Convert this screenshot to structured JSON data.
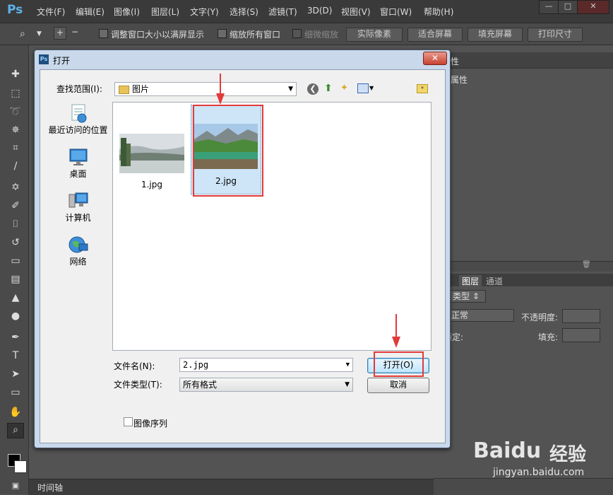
{
  "app": {
    "logo": "Ps",
    "accent": "#5eb1e8"
  },
  "menu": [
    "文件(F)",
    "编辑(E)",
    "图像(I)",
    "图层(L)",
    "文字(Y)",
    "选择(S)",
    "滤镜(T)",
    "3D(D)",
    "视图(V)",
    "窗口(W)",
    "帮助(H)"
  ],
  "window_controls": {
    "minimize": "—",
    "maximize": "□",
    "close": "✕"
  },
  "options": {
    "resize_windows": "调整窗口大小以满屏显示",
    "zoom_all": "缩放所有窗口",
    "scrubby_zoom": "细微缩放",
    "actual_pixels": "实际像素",
    "fit_screen": "适合屏幕",
    "fill_screen": "填充屏幕",
    "print_size": "打印尺寸"
  },
  "right_panel": {
    "properties_tab": "属性",
    "layers_tab": "图层",
    "channels_tab": "通道",
    "kind_label": "类型",
    "blend_mode": "正常",
    "opacity_label": "不透明度:",
    "lock_label": "锁定:",
    "fill_label": "填充:"
  },
  "timeline": {
    "label": "时间轴"
  },
  "dialog": {
    "title": "打开",
    "look_in_label": "查找范围(I):",
    "look_in_value": "图片",
    "places": [
      "最近访问的位置",
      "桌面",
      "计算机",
      "网络"
    ],
    "files": [
      {
        "name": "1.jpg",
        "selected": false
      },
      {
        "name": "2.jpg",
        "selected": true
      }
    ],
    "filename_label": "文件名(N):",
    "filename_value": "2.jpg",
    "filetype_label": "文件类型(T):",
    "filetype_value": "所有格式",
    "open_button": "打开(O)",
    "cancel_button": "取消",
    "image_sequence": "图像序列",
    "close": "✕"
  },
  "watermark": {
    "brand": "Baidu",
    "sub": "经验",
    "url": "jingyan.baidu.com"
  }
}
